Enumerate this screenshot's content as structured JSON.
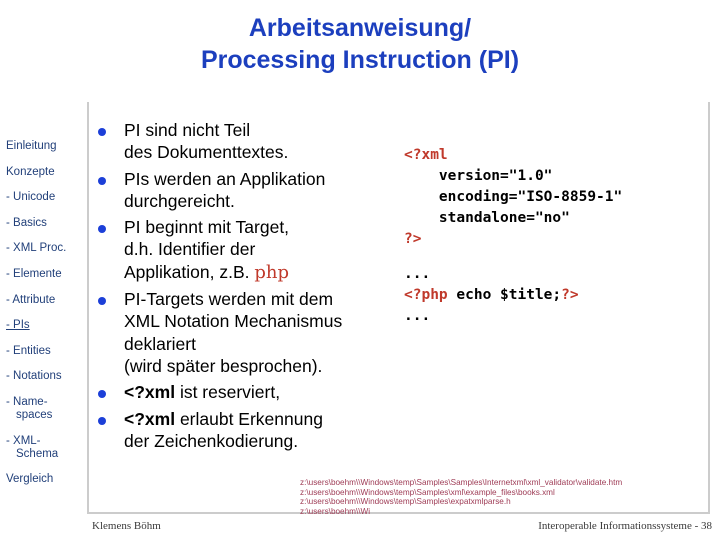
{
  "title": {
    "line1": "Arbeitsanweisung/",
    "line2": "Processing Instruction (PI)",
    "color": "#1c3fbe"
  },
  "sidebar": {
    "items": [
      {
        "label": "Einleitung",
        "active": false
      },
      {
        "label": "Konzepte",
        "active": false
      },
      {
        "label": "- Unicode",
        "active": false
      },
      {
        "label": "- Basics",
        "active": false
      },
      {
        "label": "- XML Proc.",
        "active": false
      },
      {
        "label": "- Elemente",
        "active": false
      },
      {
        "label": "- Attribute",
        "active": false
      },
      {
        "label": "- PIs",
        "active": true
      },
      {
        "label": "- Entities",
        "active": false
      },
      {
        "label": "- Notations",
        "active": false
      },
      {
        "label": "- Name-",
        "label2": "spaces",
        "active": false
      },
      {
        "label": "- XML-",
        "label2": "Schema",
        "active": false
      },
      {
        "label": "Vergleich",
        "active": false
      }
    ],
    "text_color": "#22407a"
  },
  "content": {
    "bullet_color": "#1c3fd8",
    "bullets": [
      {
        "line1": "PI sind nicht Teil",
        "line2": "des Dokumenttextes."
      },
      {
        "line1": "PIs werden an Applikation",
        "line2": "durchgereicht."
      },
      {
        "line1": "PI beginnt mit Target,",
        "line2": "d.h. Identifier der",
        "line3_pre": "Applikation, z.B. ",
        "line3_code": "php"
      },
      {
        "line1": "PI-Targets werden mit dem",
        "line2": "XML Notation Mechanismus",
        "line3": "deklariert",
        "line4": "(wird später besprochen)."
      },
      {
        "bold": "<?xml",
        "rest": " ist reserviert,"
      },
      {
        "bold": "<?xml",
        "rest": " erlaubt Erkennung",
        "line2": "der Zeichenkodierung."
      }
    ]
  },
  "code": {
    "keyword_color": "#c0392b",
    "block1": [
      {
        "kw": "<?xml",
        "text": ""
      },
      {
        "kw": "",
        "text": "    version=\"1.0\""
      },
      {
        "kw": "",
        "text": "    encoding=\"ISO-8859-1\""
      },
      {
        "kw": "",
        "text": "    standalone=\"no\""
      },
      {
        "kw": "?>",
        "text": ""
      }
    ],
    "block2": [
      {
        "kw": "",
        "text": "..."
      },
      {
        "kw": "<?php",
        "text": " echo $title;",
        "kw2": "?>"
      },
      {
        "kw": "",
        "text": "..."
      }
    ]
  },
  "paths": {
    "color": "#9e3b55",
    "lines": [
      "z:\\users\\boehm\\\\Windows\\temp\\Samples\\Samples\\Internetxml\\xml_validator\\validate.htm",
      "z:\\users\\boehm\\\\Windows\\temp\\Samples\\xml\\example_files\\books.xml",
      "z:\\users\\boehm\\\\Windows\\temp\\Samples\\expatxmlparse.h",
      "z:\\users\\boehm\\\\Wi"
    ]
  },
  "footer": {
    "author": "Klemens Böhm",
    "course": "Interoperable Informationssysteme - 38"
  }
}
